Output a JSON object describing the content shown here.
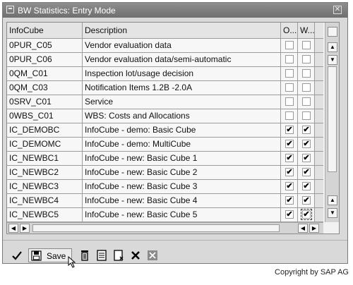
{
  "window": {
    "title": "BW Statistics: Entry Mode"
  },
  "table": {
    "columns": [
      "InfoCube",
      "Description",
      "O...",
      "W..."
    ],
    "rows": [
      {
        "infocube": "0PUR_C05",
        "description": "Vendor evaluation data",
        "o": false,
        "w": false
      },
      {
        "infocube": "0PUR_C06",
        "description": "Vendor evaluation data/semi-automatic",
        "o": false,
        "w": false
      },
      {
        "infocube": "0QM_C01",
        "description": "Inspection lot/usage decision",
        "o": false,
        "w": false
      },
      {
        "infocube": "0QM_C03",
        "description": "Notification Items 1.2B -2.0A",
        "o": false,
        "w": false
      },
      {
        "infocube": "0SRV_C01",
        "description": "Service",
        "o": false,
        "w": false
      },
      {
        "infocube": "0WBS_C01",
        "description": "WBS: Costs and Allocations",
        "o": false,
        "w": false
      },
      {
        "infocube": "IC_DEMOBC",
        "description": "InfoCube - demo: Basic Cube",
        "o": true,
        "w": true
      },
      {
        "infocube": "IC_DEMOMC",
        "description": "InfoCube - demo: MultiCube",
        "o": true,
        "w": true
      },
      {
        "infocube": "IC_NEWBC1",
        "description": "InfoCube - new: Basic Cube 1",
        "o": true,
        "w": true
      },
      {
        "infocube": "IC_NEWBC2",
        "description": "InfoCube - new: Basic Cube 2",
        "o": true,
        "w": true
      },
      {
        "infocube": "IC_NEWBC3",
        "description": "InfoCube - new: Basic Cube 3",
        "o": true,
        "w": true
      },
      {
        "infocube": "IC_NEWBC4",
        "description": "InfoCube - new: Basic Cube 4",
        "o": true,
        "w": true
      },
      {
        "infocube": "IC_NEWBC5",
        "description": "InfoCube - new: Basic Cube 5",
        "o": true,
        "w": true
      }
    ]
  },
  "toolbar": {
    "buttons": [
      "check-icon",
      "save-icon",
      "delete-icon",
      "details-icon",
      "new-entry-icon",
      "cancel-icon",
      "close-icon"
    ],
    "save_label": "Save"
  },
  "footer": {
    "copyright": "Copyright by SAP AG"
  },
  "colors": {
    "titlebar": "#7f7f7f",
    "window": "#d9d9d9",
    "table_bg": "#f7f7f7"
  }
}
